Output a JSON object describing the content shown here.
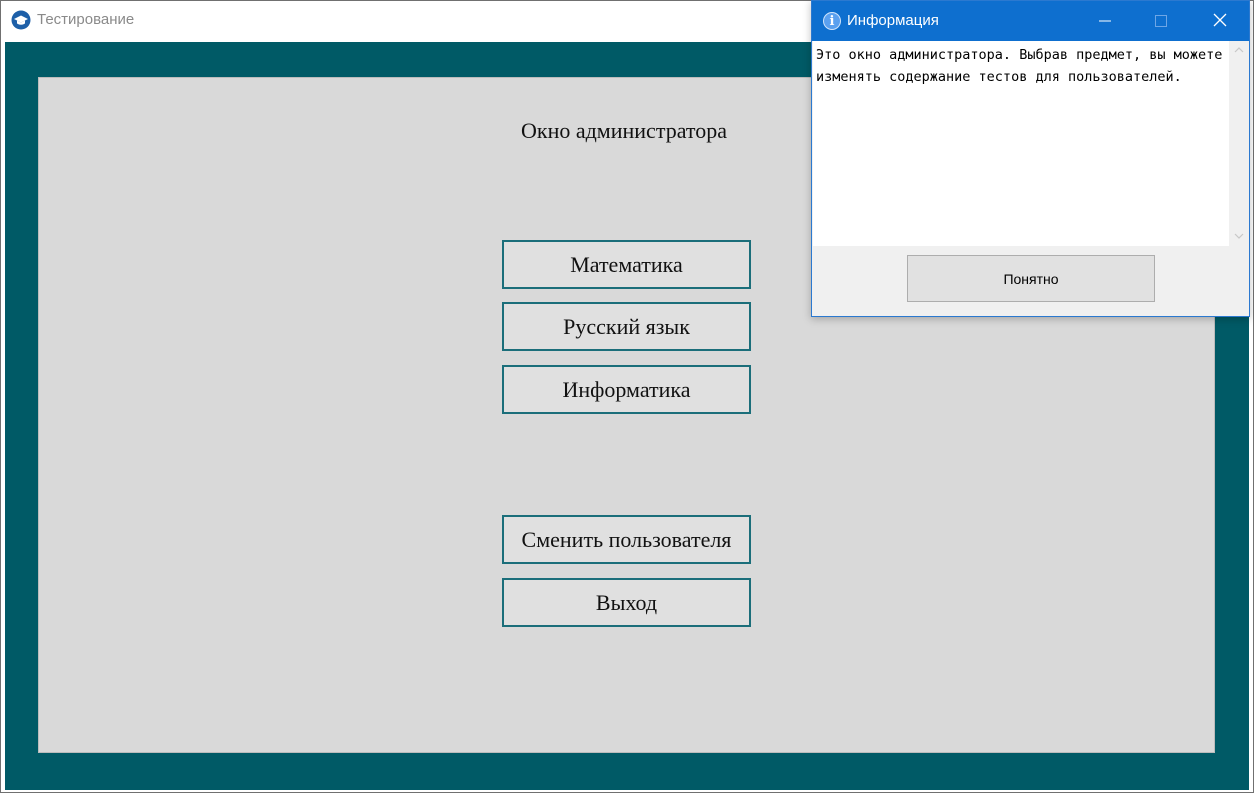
{
  "main_window": {
    "title": "Тестирование",
    "panel_title": "Окно администратора",
    "subjects": [
      {
        "label": "Математика"
      },
      {
        "label": "Русский язык"
      },
      {
        "label": "Информатика"
      }
    ],
    "change_user_label": "Сменить пользователя",
    "exit_label": "Выход"
  },
  "dialog": {
    "title": "Информация",
    "message": "Это окно администратора. Выбрав предмет, вы можете изменять содержание тестов для пользователей.",
    "ok_label": "Понятно"
  },
  "icons": {
    "app": "graduation-cap-icon",
    "info": "info-icon",
    "minimize": "minimize-icon",
    "maximize": "maximize-icon",
    "close": "close-icon"
  },
  "colors": {
    "frame": "#005a66",
    "panel": "#d9d9d9",
    "button_border": "#1b6e7a",
    "dialog_titlebar": "#0e6fcf"
  }
}
